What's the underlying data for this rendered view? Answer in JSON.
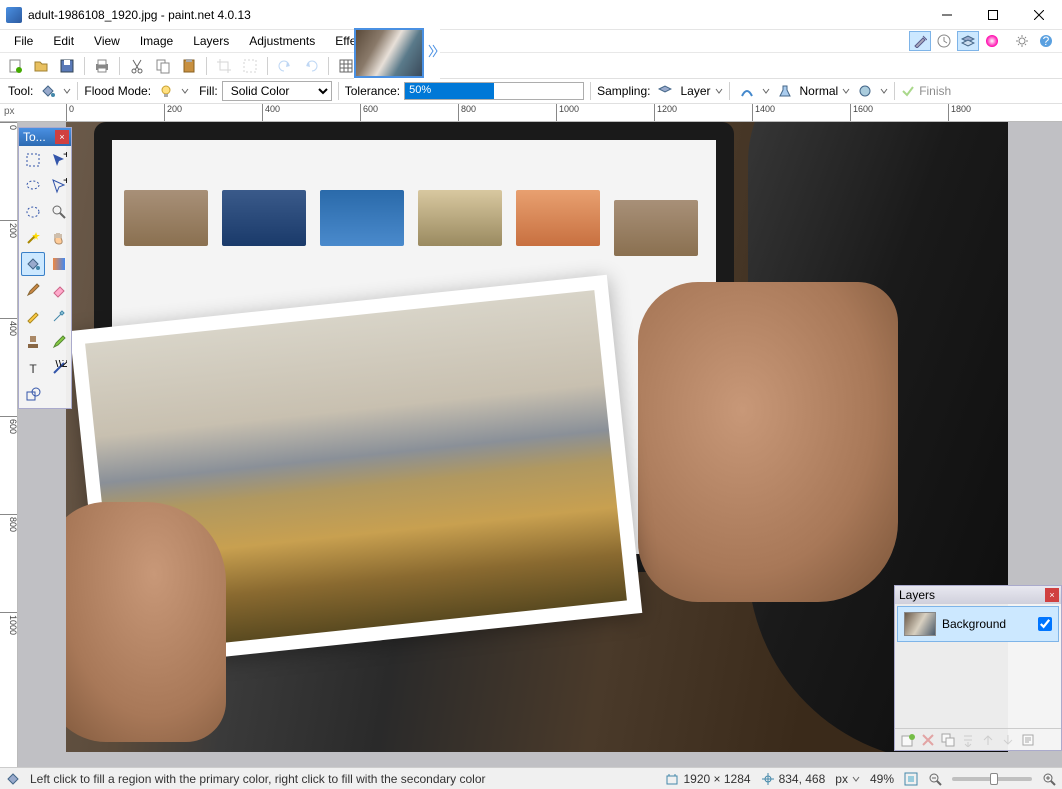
{
  "title": "adult-1986108_1920.jpg - paint.net 4.0.13",
  "menu": [
    "File",
    "Edit",
    "View",
    "Image",
    "Layers",
    "Adjustments",
    "Effects"
  ],
  "toolbar2": {
    "tool_label": "Tool:",
    "flood_mode_label": "Flood Mode:",
    "fill_label": "Fill:",
    "fill_value": "Solid Color",
    "tolerance_label": "Tolerance:",
    "tolerance_value": "50%",
    "sampling_label": "Sampling:",
    "sampling_value": "Layer",
    "blend_value": "Normal",
    "finish_label": "Finish"
  },
  "ruler_unit": "px",
  "h_ticks": [
    "0",
    "200",
    "400",
    "600",
    "800",
    "1000",
    "1200",
    "1400",
    "1600",
    "1800"
  ],
  "v_ticks": [
    "0",
    "200",
    "400",
    "600",
    "800",
    "1000"
  ],
  "tools_panel": {
    "title": "To..."
  },
  "layers_panel": {
    "title": "Layers",
    "layer_name": "Background",
    "layer_visible": true
  },
  "status": {
    "help": "Left click to fill a region with the primary color, right click to fill with the secondary color",
    "image_size": "1920 × 1284",
    "cursor_pos": "834, 468",
    "unit": "px",
    "zoom": "49%"
  }
}
